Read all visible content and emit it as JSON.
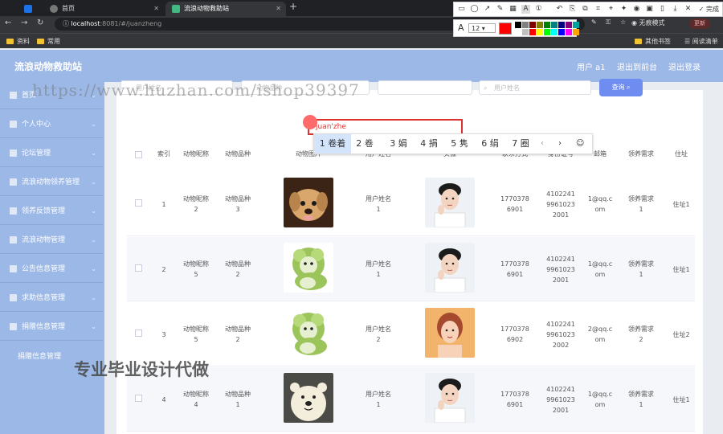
{
  "browser": {
    "tabs": [
      {
        "title": "",
        "color": "#1a73e8"
      },
      {
        "title": "首页",
        "color": "#555555"
      },
      {
        "title": "流浪动物救助站",
        "color": "#42b883"
      }
    ],
    "url_host": "localhost",
    "url_path": ":8081/#/juanzheng",
    "incognito": "无痕模式",
    "update": "更新",
    "done": "完成",
    "bookmarks": [
      "资料",
      "常用"
    ],
    "bookmarks_right": [
      "其他书签",
      "阅读清单"
    ]
  },
  "shot_tool": {
    "font_size": "12",
    "current_color": "#ff0000",
    "palette": [
      "#000000",
      "#808080",
      "#800000",
      "#808000",
      "#008000",
      "#008080",
      "#000080",
      "#800080",
      "#00a0a0",
      "#ffffff",
      "#c0c0c0",
      "#ff0000",
      "#ffff00",
      "#00ff00",
      "#00ffff",
      "#0000ff",
      "#ff00ff",
      "#ffa500"
    ]
  },
  "header": {
    "brand": "流浪动物救助站",
    "user": "用户 a1",
    "back": "退出到前台",
    "logout": "退出登录"
  },
  "sidebar": {
    "items": [
      "首页",
      "个人中心",
      "论坛管理",
      "流浪动物领养管理",
      "领养反馈管理",
      "流浪动物管理",
      "公告信息管理",
      "求助信息管理",
      "捐赠信息管理"
    ],
    "sub": "捐赠信息管理"
  },
  "search": {
    "p1": "用户姓名",
    "p2": "动物品种",
    "p3": "用户姓名",
    "query": "查询"
  },
  "watermark": "https://www.huzhan.com/ishop39397",
  "ime": {
    "typed": "juan'zhe",
    "candidates": [
      "1 卷着",
      "2 卷",
      "3 娟",
      "4 捐",
      "5 隽",
      "6 绢",
      "7 圈"
    ]
  },
  "table": {
    "headers": [
      "索引",
      "动物昵称",
      "动物品种",
      "动物图片",
      "用户姓名",
      "头像",
      "联系方式",
      "身份证号",
      "邮箱",
      "领养需求",
      "住址"
    ],
    "rows": [
      {
        "idx": "1",
        "name": "动物昵称2",
        "breed": "动物品种3",
        "user": "用户姓名1",
        "phone": "17703786901",
        "idno": "410224199610232001",
        "email": "1@qq.com",
        "need": "领养需求1",
        "addr": "住址1",
        "pet": "dog",
        "av": "man"
      },
      {
        "idx": "2",
        "name": "动物昵称5",
        "breed": "动物品种2",
        "user": "用户姓名1",
        "phone": "17703786901",
        "idno": "410224199610232001",
        "email": "1@qq.com",
        "need": "领养需求1",
        "addr": "住址1",
        "pet": "cabbage",
        "av": "man"
      },
      {
        "idx": "3",
        "name": "动物昵称5",
        "breed": "动物品种2",
        "user": "用户姓名2",
        "phone": "17703786902",
        "idno": "410224199610232002",
        "email": "2@qq.com",
        "need": "领养需求2",
        "addr": "住址2",
        "pet": "cabbage",
        "av": "woman"
      },
      {
        "idx": "4",
        "name": "动物昵称4",
        "breed": "动物品种1",
        "user": "用户姓名1",
        "phone": "17703786901",
        "idno": "410224199610232001",
        "email": "1@qq.com",
        "need": "领养需求1",
        "addr": "住址1",
        "pet": "bear",
        "av": "man"
      }
    ]
  },
  "overlay_text": "专业毕业设计代做"
}
